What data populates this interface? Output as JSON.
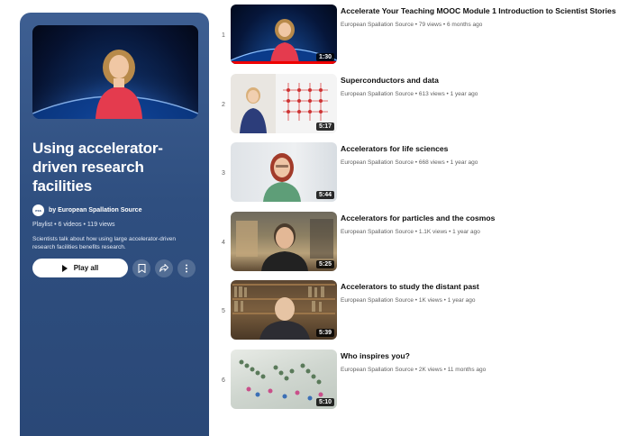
{
  "playlist": {
    "title": "Using accelerator-driven research facilities",
    "owner": "by European Spallation Source",
    "avatar_text": "ess",
    "meta": "Playlist • 6 videos • 119 views",
    "description": "Scientists talk about how using large accelerator-driven research facilities benefits research.",
    "play_all_label": "Play all",
    "icons": [
      "save-icon",
      "share-icon",
      "more-icon"
    ]
  },
  "videos": [
    {
      "index": "1",
      "title": "Accelerate Your Teaching MOOC Module 1 Introduction to Scientist Stories",
      "channel": "European Spallation Source",
      "stats": "European Spallation Source • 79 views • 6 months ago",
      "duration": "1:30",
      "watched": 1.0
    },
    {
      "index": "2",
      "title": "Superconductors and data",
      "stats": "European Spallation Source • 613 views • 1 year ago",
      "duration": "5:17"
    },
    {
      "index": "3",
      "title": "Accelerators for life sciences",
      "stats": "European Spallation Source • 668 views • 1 year ago",
      "duration": "5:44"
    },
    {
      "index": "4",
      "title": "Accelerators for particles and the cosmos",
      "stats": "European Spallation Source • 1.1K views • 1 year ago",
      "duration": "5:25"
    },
    {
      "index": "5",
      "title": "Accelerators to study the distant past",
      "stats": "European Spallation Source • 1K views • 1 year ago",
      "duration": "5:39"
    },
    {
      "index": "6",
      "title": "Who inspires you?",
      "stats": "European Spallation Source • 2K views • 11 months ago",
      "duration": "5:10"
    }
  ],
  "colors": {
    "panel": "#2f4f80",
    "progress": "#e00000"
  }
}
